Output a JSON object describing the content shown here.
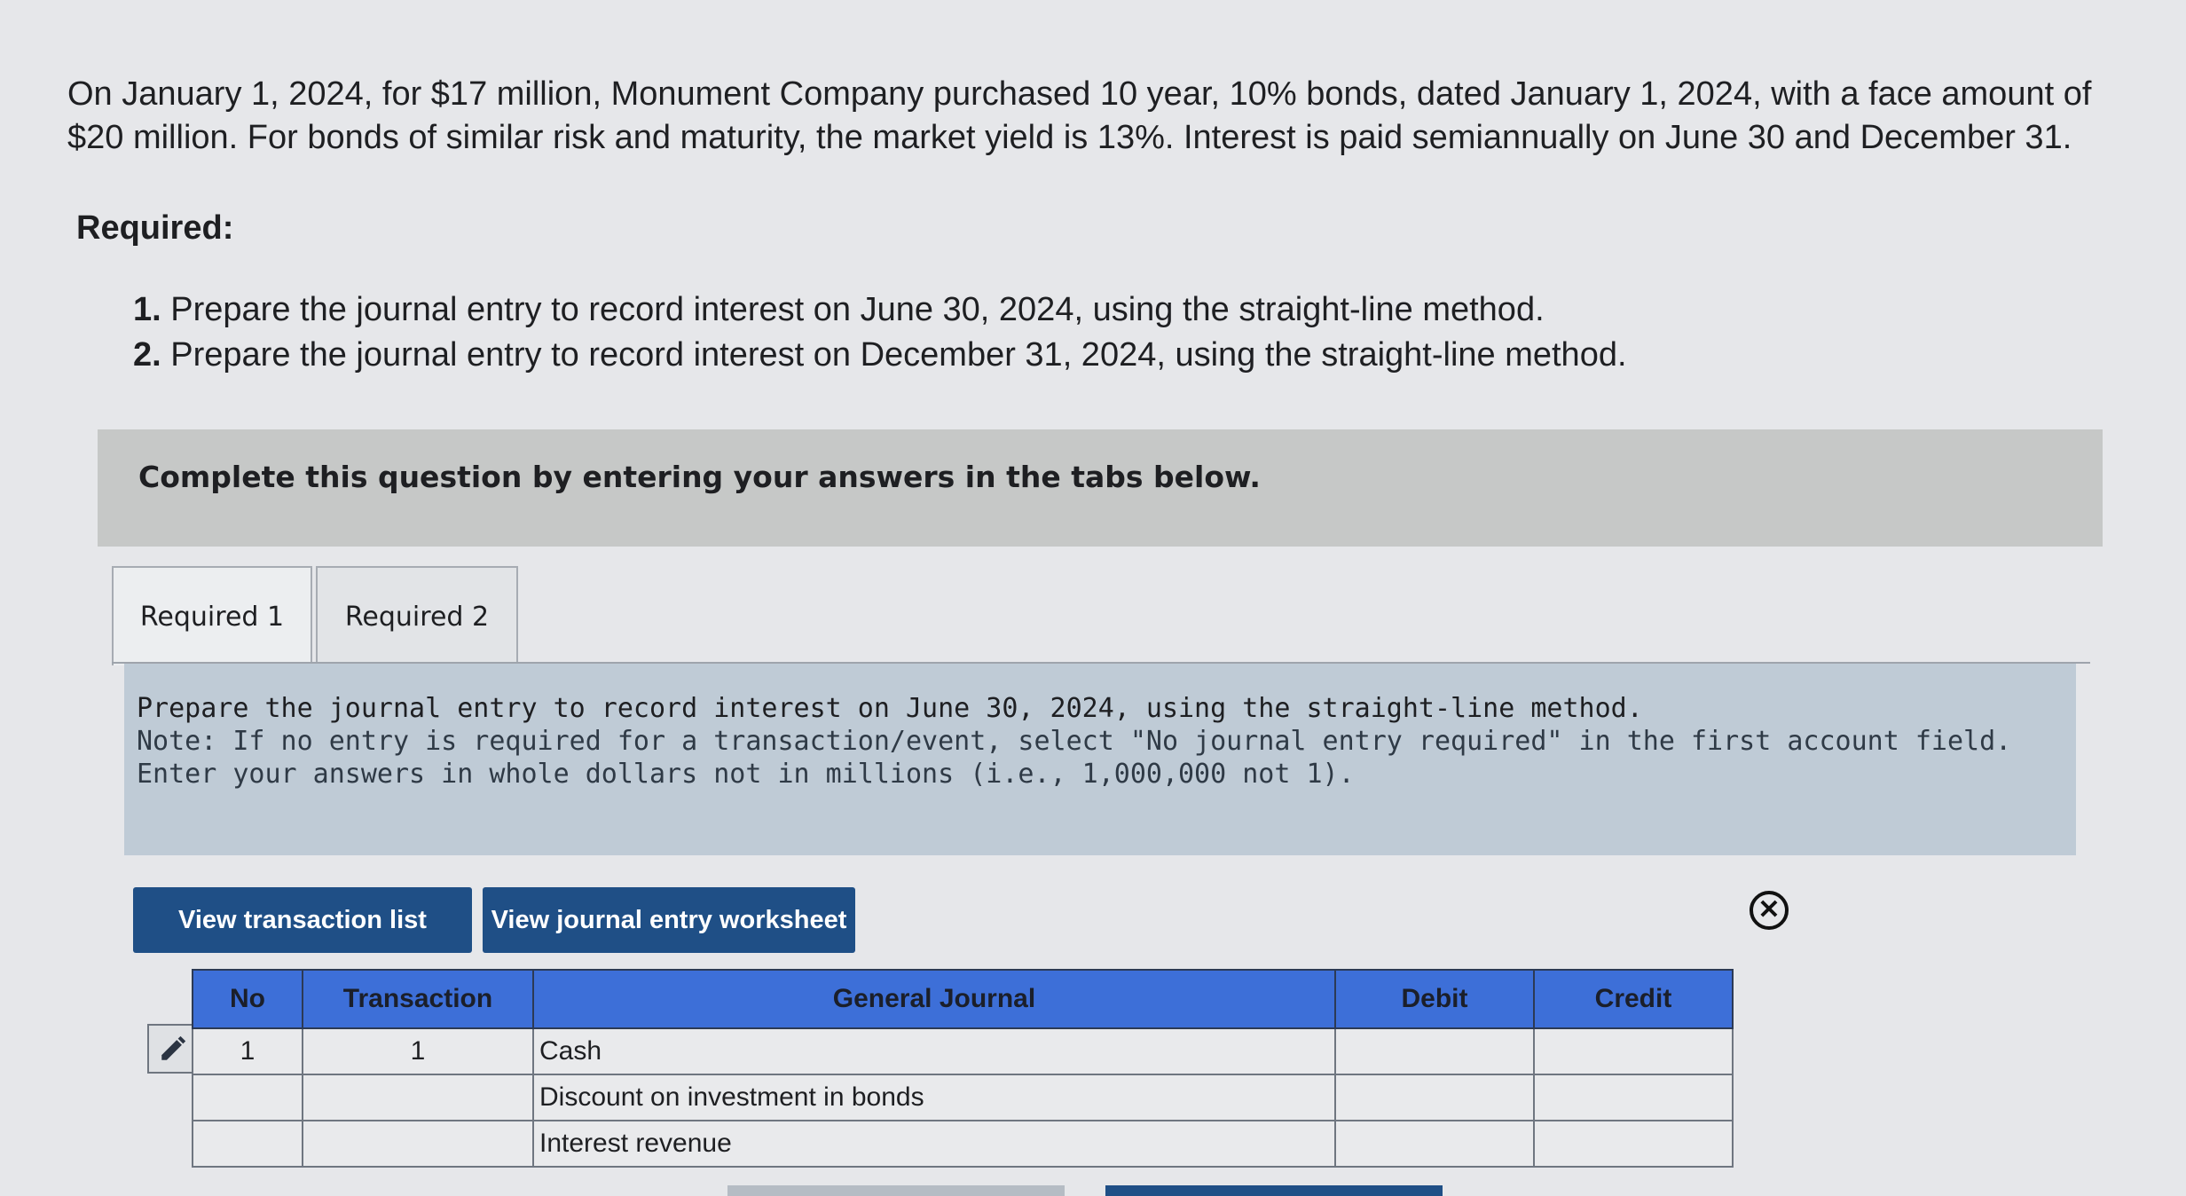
{
  "problem": {
    "text": "On January 1, 2024, for $17 million, Monument Company purchased 10 year, 10% bonds, dated January 1, 2024, with a face amount of $20 million. For bonds of similar risk and maturity, the market yield is 13%. Interest is paid semiannually on June 30 and December 31."
  },
  "required": {
    "heading": "Required:",
    "items": [
      {
        "num": "1.",
        "text": "Prepare the journal entry to record interest on June 30, 2024, using the straight-line method."
      },
      {
        "num": "2.",
        "text": "Prepare the journal entry to record interest on December 31, 2024, using the straight-line method."
      }
    ]
  },
  "banner": {
    "text": "Complete this question by entering your answers in the tabs below."
  },
  "tabs": [
    {
      "label": "Required 1"
    },
    {
      "label": "Required 2"
    }
  ],
  "instructions": {
    "line1": "Prepare the journal entry to record interest on June 30, 2024, using the straight-line method.",
    "note": "Note: If no entry is required for a transaction/event, select \"No journal entry required\" in the first account field. Enter your answers in whole dollars not in millions (i.e., 1,000,000 not 1)."
  },
  "buttons": {
    "view_transaction_list": "View transaction list",
    "view_journal_entry_worksheet": "View journal entry worksheet"
  },
  "journal": {
    "headers": {
      "no": "No",
      "transaction": "Transaction",
      "general_journal": "General Journal",
      "debit": "Debit",
      "credit": "Credit"
    },
    "rows": [
      {
        "no": "1",
        "transaction": "1",
        "account": "Cash",
        "debit": "",
        "credit": ""
      },
      {
        "no": "",
        "transaction": "",
        "account": "Discount on investment in bonds",
        "debit": "",
        "credit": ""
      },
      {
        "no": "",
        "transaction": "",
        "account": "Interest revenue",
        "debit": "",
        "credit": ""
      }
    ]
  },
  "icons": {
    "close": "close-circle-icon",
    "edit": "pencil-icon"
  }
}
